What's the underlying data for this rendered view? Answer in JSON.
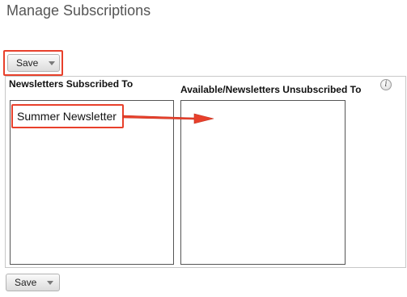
{
  "page": {
    "title": "Manage Subscriptions"
  },
  "toolbar_top": {
    "save_label": "Save"
  },
  "toolbar_bottom": {
    "save_label": "Save"
  },
  "subscribed": {
    "title": "Newsletters Subscribed To",
    "items": [
      "Summer Newsletter"
    ]
  },
  "unsubscribed": {
    "title": "Available/Newsletters Unsubscribed To",
    "items": [],
    "info_icon": "info-icon"
  },
  "colors": {
    "highlight": "#e8402b",
    "panel_border": "#c8c8c8"
  }
}
